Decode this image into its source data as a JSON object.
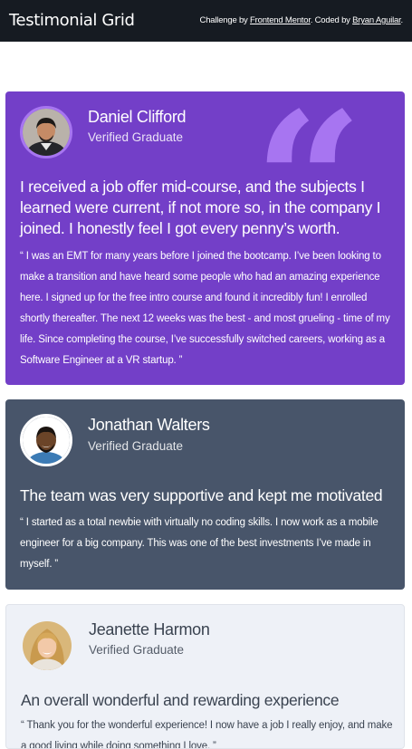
{
  "header": {
    "title": "Testimonial Grid",
    "attribution_prefix": "Challenge by ",
    "attribution_link_1": "Frontend Mentor",
    "attribution_middle": ". Coded by ",
    "attribution_link_2": "Bryan Aguilar",
    "attribution_suffix": "."
  },
  "testimonials": [
    {
      "name": "Daniel Clifford",
      "role": "Verified Graduate",
      "headline": "I received a job offer mid-course, and the subjects I learned were current, if not more so, in the company I joined. I honestly feel I got every penny’s worth.",
      "quote": "“ I was an EMT for many years before I joined the bootcamp. I’ve been looking to make a transition and have heard some people who had an amazing experience here. I signed up for the free intro course and found it incredibly fun! I enrolled shortly thereafter. The next 12 weeks was the best - and most grueling - time of my life. Since completing the course, I’ve successfully switched careers, working as a Software Engineer at a VR startup. ”",
      "background": "#733fc8"
    },
    {
      "name": "Jonathan Walters",
      "role": "Verified Graduate",
      "headline": "The team was very supportive and kept me motivated",
      "quote": "“ I started as a total newbie with virtually no coding skills. I now work as a mobile engineer for a big company. This was one of the best investments I’ve made in myself. ”",
      "background": "#48556a"
    },
    {
      "name": "Jeanette Harmon",
      "role": "Verified Graduate",
      "headline": "An overall wonderful and rewarding experience",
      "quote": "“ Thank you for the wonderful experience! I now have a job I really enjoy, and make a good living while doing something I love. ”",
      "background": "#eef1f7"
    }
  ],
  "icons": {
    "quote": "quotation-mark-icon"
  },
  "colors": {
    "topbar": "#161b22",
    "accent_purple": "#733fc8",
    "quote_mark": "#a775f1",
    "slate": "#48556a",
    "light_card": "#eef1f7"
  }
}
